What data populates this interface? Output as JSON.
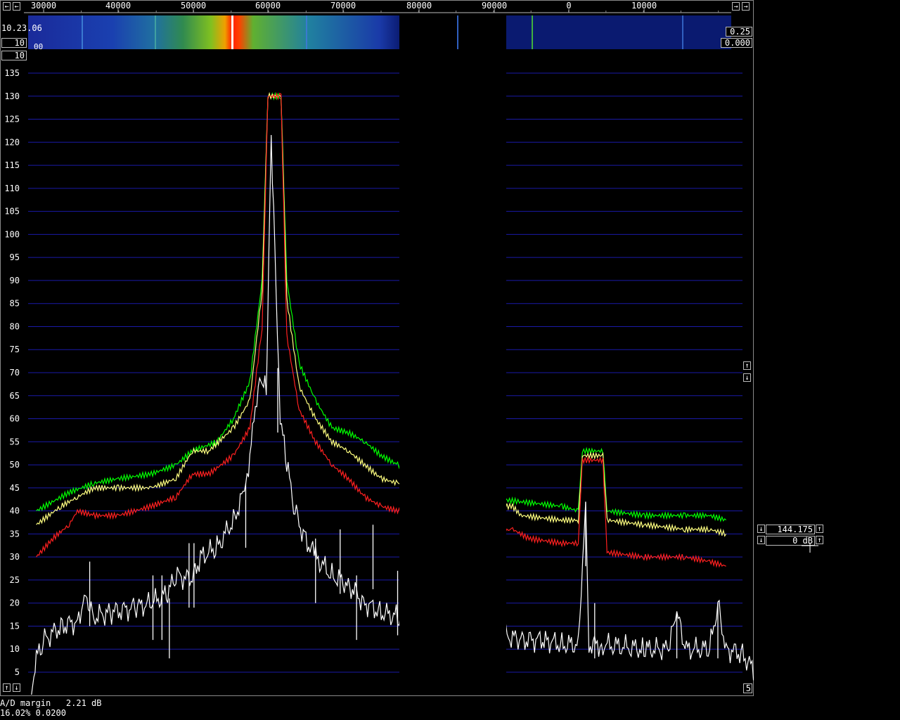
{
  "header": {
    "time": "10.23.06",
    "avg_left": "10",
    "db_label": "00",
    "avg_main": "10",
    "gain_right": "0.25",
    "offset_right": "0.000",
    "arrow_left": "←",
    "arrow_right": "→"
  },
  "frequency_axis": {
    "ticks": [
      "30000",
      "40000",
      "50000",
      "60000",
      "70000",
      "80000",
      "90000",
      "0",
      "10000"
    ]
  },
  "side_controls": {
    "up_arrow": "↑",
    "down_arrow": "↓",
    "frequency_value": "144.175",
    "gain_value": "0 dB"
  },
  "bottom_right_box": "5",
  "status": {
    "ad_margin": "A/D margin   2.21 dB",
    "percentage": "16.02% 0.0200"
  },
  "colors": {
    "grid": "#1a1aa8",
    "green": "#00ff00",
    "yellow": "#ffff80",
    "red": "#ff2020",
    "white": "#ffffff"
  },
  "chart_data": {
    "type": "line",
    "y_ticks": [
      "5",
      "10",
      "15",
      "20",
      "25",
      "30",
      "35",
      "40",
      "45",
      "50",
      "55",
      "60",
      "65",
      "70",
      "75",
      "80",
      "85",
      "90",
      "95",
      "100",
      "105",
      "110",
      "115",
      "120",
      "125",
      "130",
      "135"
    ],
    "ylim": [
      0,
      138
    ],
    "xlim": [
      25000,
      112000
    ],
    "series": [
      {
        "color": "green",
        "points": [
          [
            26000,
            40
          ],
          [
            30000,
            44
          ],
          [
            33000,
            46
          ],
          [
            36000,
            47
          ],
          [
            40000,
            48
          ],
          [
            43000,
            50
          ],
          [
            45000,
            53
          ],
          [
            48000,
            55
          ],
          [
            50000,
            60
          ],
          [
            52000,
            68
          ],
          [
            53500,
            90
          ],
          [
            54200,
            130
          ],
          [
            55800,
            130
          ],
          [
            56500,
            90
          ],
          [
            58000,
            72
          ],
          [
            60000,
            64
          ],
          [
            62000,
            58
          ],
          [
            64000,
            57
          ],
          [
            66000,
            55
          ],
          [
            68000,
            52
          ],
          [
            70000,
            50
          ],
          [
            74000,
            49
          ],
          [
            76000,
            45
          ],
          [
            80000,
            43
          ],
          [
            85000,
            42
          ],
          [
            90000,
            41
          ],
          [
            92000,
            40
          ],
          [
            92500,
            53
          ],
          [
            95000,
            53
          ],
          [
            95500,
            40
          ],
          [
            100000,
            39
          ],
          [
            105000,
            39
          ],
          [
            108000,
            39
          ],
          [
            110000,
            38
          ]
        ]
      },
      {
        "color": "yellow",
        "points": [
          [
            26000,
            37
          ],
          [
            29000,
            41
          ],
          [
            31000,
            43
          ],
          [
            33000,
            45
          ],
          [
            36000,
            45
          ],
          [
            40000,
            45
          ],
          [
            43000,
            47
          ],
          [
            45000,
            53
          ],
          [
            47000,
            53
          ],
          [
            50000,
            58
          ],
          [
            52000,
            64
          ],
          [
            53500,
            88
          ],
          [
            54200,
            130
          ],
          [
            55800,
            130
          ],
          [
            56500,
            86
          ],
          [
            58000,
            67
          ],
          [
            60000,
            60
          ],
          [
            62000,
            55
          ],
          [
            64000,
            53
          ],
          [
            66000,
            50
          ],
          [
            68000,
            47
          ],
          [
            70000,
            46
          ],
          [
            74000,
            45
          ],
          [
            76000,
            42
          ],
          [
            80000,
            41
          ],
          [
            84000,
            41
          ],
          [
            85000,
            39
          ],
          [
            90000,
            38
          ],
          [
            92000,
            38
          ],
          [
            92500,
            52
          ],
          [
            95000,
            52
          ],
          [
            95500,
            38
          ],
          [
            100000,
            37
          ],
          [
            105000,
            36
          ],
          [
            108000,
            36
          ],
          [
            110000,
            35
          ]
        ]
      },
      {
        "color": "red",
        "points": [
          [
            26000,
            30
          ],
          [
            28000,
            34
          ],
          [
            30000,
            37
          ],
          [
            31000,
            40
          ],
          [
            33000,
            39
          ],
          [
            36000,
            39
          ],
          [
            40000,
            41
          ],
          [
            43000,
            43
          ],
          [
            45000,
            48
          ],
          [
            47000,
            48
          ],
          [
            50000,
            52
          ],
          [
            52000,
            58
          ],
          [
            53500,
            80
          ],
          [
            54200,
            130
          ],
          [
            55800,
            130
          ],
          [
            56500,
            78
          ],
          [
            58000,
            62
          ],
          [
            60000,
            55
          ],
          [
            62000,
            50
          ],
          [
            64000,
            47
          ],
          [
            66000,
            43
          ],
          [
            68000,
            41
          ],
          [
            70000,
            40
          ],
          [
            74000,
            39
          ],
          [
            76000,
            36
          ],
          [
            80000,
            35
          ],
          [
            84000,
            36
          ],
          [
            86000,
            34
          ],
          [
            90000,
            33
          ],
          [
            92000,
            33
          ],
          [
            92500,
            51
          ],
          [
            95000,
            51
          ],
          [
            95500,
            31
          ],
          [
            100000,
            30
          ],
          [
            105000,
            30
          ],
          [
            108000,
            29
          ],
          [
            110000,
            28
          ]
        ]
      },
      {
        "color": "white",
        "points": [
          [
            25400,
            0
          ],
          [
            26000,
            8
          ],
          [
            27000,
            12
          ],
          [
            29000,
            15
          ],
          [
            31000,
            16
          ],
          [
            32000,
            22
          ],
          [
            33000,
            17
          ],
          [
            35000,
            18
          ],
          [
            38000,
            19
          ],
          [
            40000,
            20
          ],
          [
            42000,
            22
          ],
          [
            43000,
            26
          ],
          [
            45000,
            25
          ],
          [
            46000,
            30
          ],
          [
            48000,
            32
          ],
          [
            50000,
            38
          ],
          [
            51500,
            45
          ],
          [
            52500,
            60
          ],
          [
            53200,
            70
          ],
          [
            54000,
            66
          ],
          [
            54600,
            122
          ],
          [
            55200,
            88
          ],
          [
            55700,
            60
          ],
          [
            56500,
            50
          ],
          [
            57500,
            40
          ],
          [
            58500,
            35
          ],
          [
            60000,
            30
          ],
          [
            62000,
            26
          ],
          [
            64000,
            24
          ],
          [
            66000,
            20
          ],
          [
            68000,
            18
          ],
          [
            70000,
            17
          ],
          [
            72000,
            16
          ],
          [
            75000,
            15
          ],
          [
            80000,
            14
          ],
          [
            82000,
            16
          ],
          [
            83000,
            13
          ],
          [
            85000,
            12
          ],
          [
            88000,
            12
          ],
          [
            90000,
            11
          ],
          [
            92000,
            11
          ],
          [
            92900,
            42
          ],
          [
            93300,
            11
          ],
          [
            95000,
            11
          ],
          [
            100000,
            10
          ],
          [
            103000,
            10
          ],
          [
            104000,
            18
          ],
          [
            105000,
            10
          ],
          [
            108000,
            10
          ],
          [
            109000,
            20
          ],
          [
            110000,
            10
          ],
          [
            112000,
            9
          ],
          [
            113500,
            5
          ],
          [
            114000,
            0
          ]
        ]
      }
    ],
    "spikes": [
      [
        32500,
        29
      ],
      [
        40200,
        26
      ],
      [
        41300,
        26
      ],
      [
        42200,
        21
      ],
      [
        44600,
        33
      ],
      [
        45200,
        33
      ],
      [
        51500,
        46
      ],
      [
        55400,
        71
      ],
      [
        60000,
        34
      ],
      [
        63000,
        36
      ],
      [
        65000,
        26
      ],
      [
        67000,
        37
      ],
      [
        70000,
        27
      ],
      [
        77000,
        13
      ],
      [
        83000,
        25
      ],
      [
        92900,
        42
      ],
      [
        94000,
        20
      ],
      [
        104000,
        18
      ],
      [
        109000,
        20
      ]
    ]
  }
}
